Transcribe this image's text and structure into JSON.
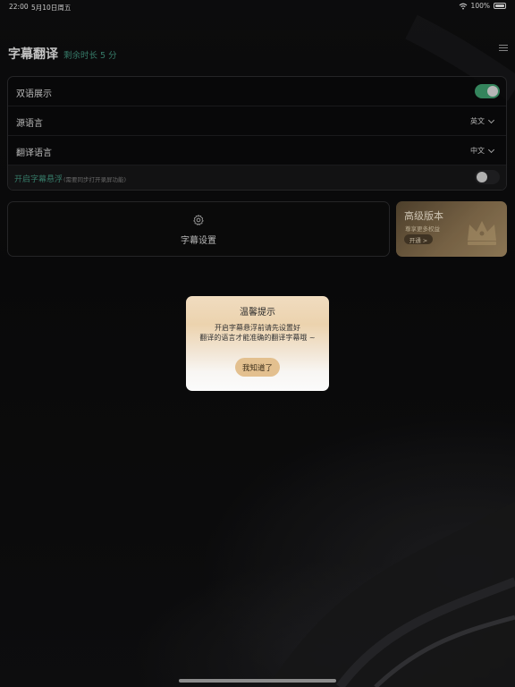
{
  "status_bar": {
    "time": "22:00",
    "date": "5月10日周五",
    "battery": "100%"
  },
  "header": {
    "title": "字幕翻译",
    "remaining": "剩余时长 5 分"
  },
  "settings": {
    "bilingual_label": "双语展示",
    "bilingual_on": true,
    "source_lang_label": "源语言",
    "source_lang_value": "英文",
    "target_lang_label": "翻译语言",
    "target_lang_value": "中文",
    "float_label": "开启字幕悬浮",
    "float_hint": "(需要同步打开录屏功能)",
    "float_on": false
  },
  "subtitle_settings": {
    "label": "字幕设置"
  },
  "premium": {
    "title": "高级版本",
    "subtitle": "尊享更多权益",
    "open_label": "开通 >"
  },
  "dialog": {
    "title": "温馨提示",
    "message_line1": "开启字幕悬浮前请先设置好",
    "message_line2": "翻译的语言才能准确的翻译字幕哦 ~",
    "button_label": "我知道了"
  },
  "colors": {
    "accent_green": "#3f8f7a",
    "toggle_green": "#3e9c6d",
    "gold": "#a38a63",
    "dialog_button": "#e3c08f"
  }
}
